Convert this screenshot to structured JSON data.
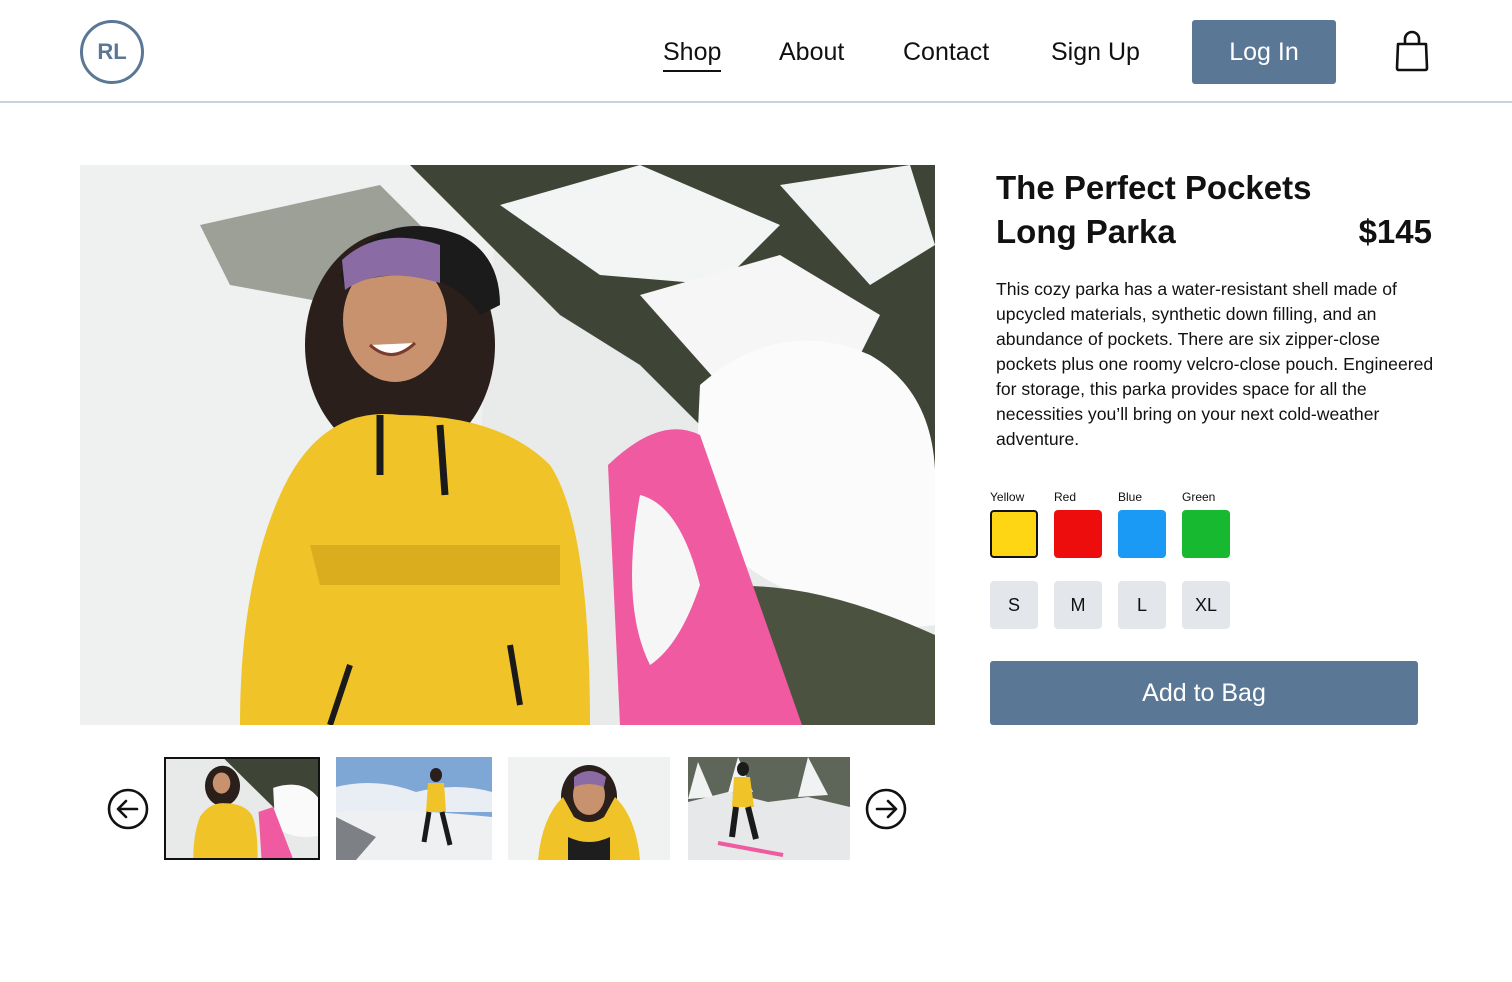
{
  "header": {
    "logo_text": "RL",
    "nav": [
      {
        "label": "Shop",
        "active": true
      },
      {
        "label": "About"
      },
      {
        "label": "Contact"
      },
      {
        "label": "Sign Up"
      }
    ],
    "login_label": "Log In",
    "bag_icon": "shopping-bag-icon"
  },
  "product": {
    "title": "The Perfect Pockets Long Parka",
    "price": "$145",
    "description": "This cozy parka has a water-resistant shell made of upcycled materials, synthetic down filling, and an abundance of pockets. There are six zipper-close pockets plus one roomy velcro-close pouch. Engineered for storage, this parka provides space for all the necessities you’ll bring on your next cold-weather adventure.",
    "colors": [
      {
        "label": "Yellow",
        "hex": "#ffd614",
        "selected": true
      },
      {
        "label": "Red",
        "hex": "#ee0d0d"
      },
      {
        "label": "Blue",
        "hex": "#1b9af5"
      },
      {
        "label": "Green",
        "hex": "#16b930"
      }
    ],
    "sizes": [
      "S",
      "M",
      "L",
      "XL"
    ],
    "add_to_bag_label": "Add to Bag"
  },
  "gallery": {
    "prev_icon": "arrow-left-circle-icon",
    "next_icon": "arrow-right-circle-icon",
    "selected_index": 0,
    "thumbnail_count": 4
  },
  "colors": {
    "accent": "#5a7896",
    "divider": "#c9d3dc",
    "size_bg": "#e3e6ea"
  }
}
